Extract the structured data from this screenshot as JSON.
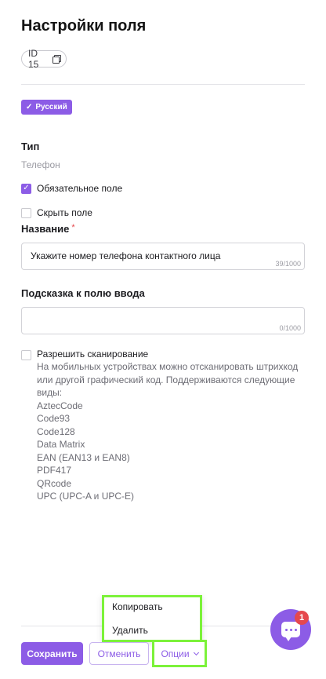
{
  "header": {
    "title": "Настройки поля",
    "id_label": "ID 15"
  },
  "language_badge": "Русский",
  "type_section": {
    "label": "Тип",
    "value": "Телефон"
  },
  "options": {
    "required_label": "Обязательное поле",
    "required_checked": true,
    "hide_label": "Скрыть поле",
    "hide_checked": false
  },
  "name_section": {
    "label": "Название",
    "required_mark": "*",
    "value": "Укажите номер телефона контактного лица",
    "counter": "39/1000"
  },
  "hint_section": {
    "label": "Подсказка к полю ввода",
    "value": "",
    "counter": "0/1000"
  },
  "scanning": {
    "checked": false,
    "label": "Разрешить сканирование",
    "description": "На мобильных устройствах можно отсканировать штрихкод или другой графический код. Поддерживаются следующие виды:",
    "formats": [
      "AztecCode",
      "Code93",
      "Code128",
      "Data Matrix",
      "EAN (EAN13 и EAN8)",
      "PDF417",
      "QRcode",
      "UPC (UPC-A и UPC-E)"
    ]
  },
  "dropdown": {
    "items": [
      "Копировать",
      "Удалить"
    ]
  },
  "chat": {
    "badge_count": "1"
  },
  "footer": {
    "save_label": "Сохранить",
    "cancel_label": "Отменить",
    "options_label": "Опции"
  },
  "colors": {
    "accent": "#8c5ce6",
    "highlight": "#7cf23a",
    "badge": "#e5484d"
  }
}
